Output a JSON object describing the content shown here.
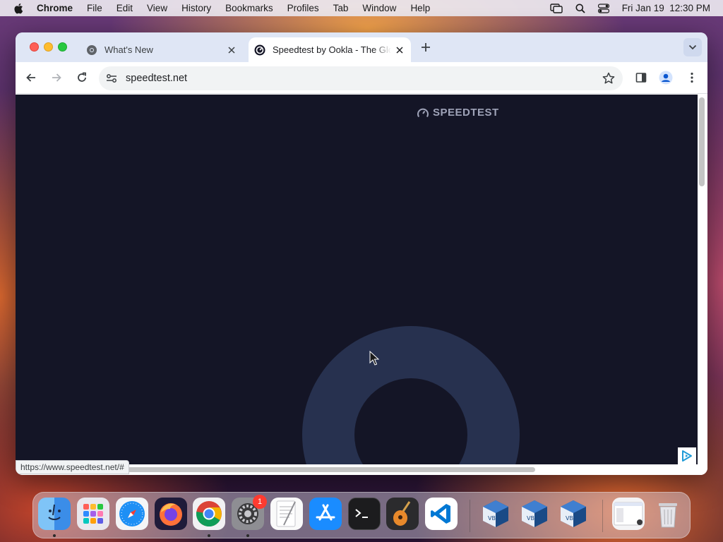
{
  "menubar": {
    "app": "Chrome",
    "items": [
      "File",
      "Edit",
      "View",
      "History",
      "Bookmarks",
      "Profiles",
      "Tab",
      "Window",
      "Help"
    ],
    "clock": "Fri Jan 19  12:30 PM"
  },
  "browser": {
    "tabs": [
      {
        "title": "What's New",
        "active": false
      },
      {
        "title": "Speedtest by Ookla - The Global Broadband Speed Test",
        "active": true
      }
    ],
    "url": "speedtest.net",
    "status_url": "https://www.speedtest.net/#"
  },
  "page": {
    "logo_text": "SPEEDTEST"
  },
  "dock": {
    "apps": [
      "finder",
      "launchpad",
      "safari",
      "firefox",
      "chrome",
      "system-settings",
      "textedit",
      "app-store",
      "terminal",
      "garageband",
      "vscode",
      "virtualbox",
      "virtualbox",
      "virtualbox",
      "preview",
      "trash"
    ],
    "settings_badge": "1"
  },
  "colors": {
    "page_bg": "#141526",
    "gauge": "#27314f",
    "tabstrip": "#dfe6f5"
  }
}
